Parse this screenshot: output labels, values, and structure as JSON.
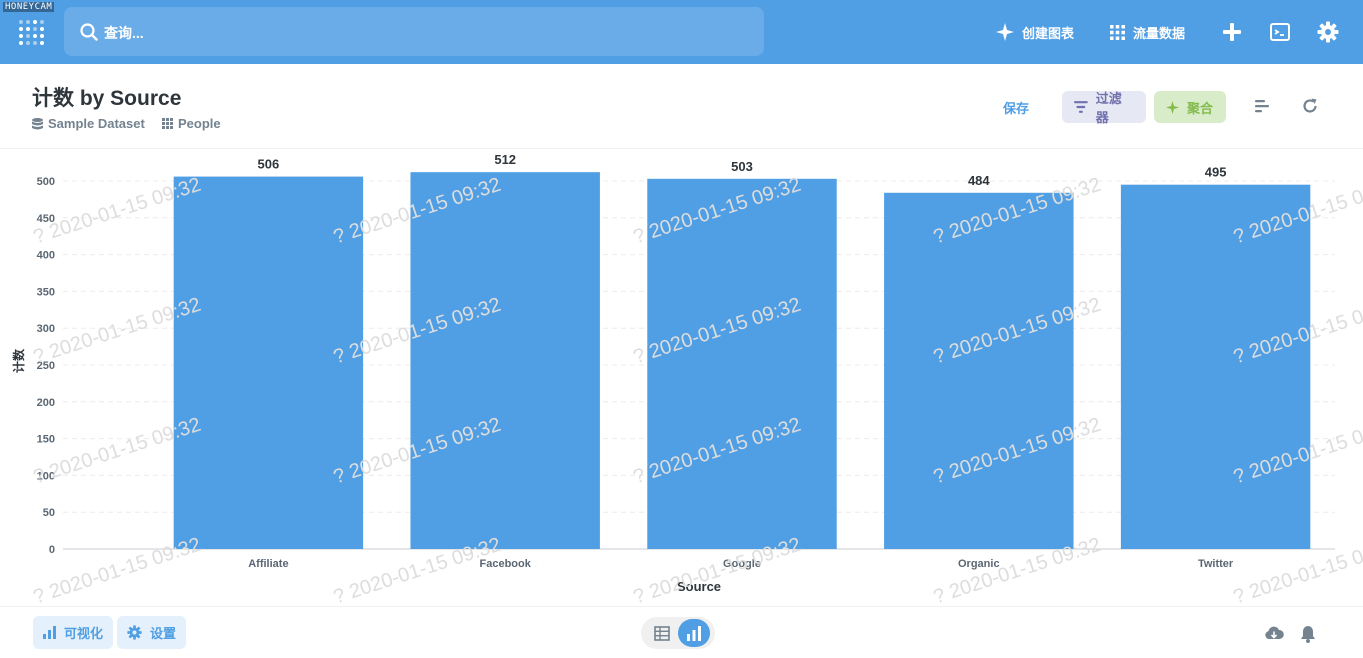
{
  "recorder_badge": "HONEYCAM",
  "nav": {
    "search_placeholder": "查询...",
    "create_chart": "创建图表",
    "browse_data": "流量数据",
    "icons": [
      "logo-icon",
      "search-icon",
      "sparkle-icon",
      "grid-icon",
      "plus-icon",
      "terminal-icon",
      "gear-icon"
    ]
  },
  "question": {
    "title": "计数 by Source",
    "database": "Sample Dataset",
    "table": "People"
  },
  "actions": {
    "save": "保存",
    "filter": "过滤器",
    "summarize": "聚合"
  },
  "watermark_text": "? 2020-01-15 09:32",
  "colors": {
    "brand": "#509ee3",
    "bar": "#509ee3",
    "filter": "#7172ad",
    "summarize": "#84bb4c"
  },
  "chart_data": {
    "type": "bar",
    "categories": [
      "Affiliate",
      "Facebook",
      "Google",
      "Organic",
      "Twitter"
    ],
    "values": [
      506,
      512,
      503,
      484,
      495
    ],
    "xlabel": "Source",
    "ylabel": "计数",
    "ylim": [
      0,
      500
    ],
    "yticks": [
      0,
      50,
      100,
      150,
      200,
      250,
      300,
      350,
      400,
      450,
      500
    ],
    "grid": true,
    "data_labels": true
  },
  "footer": {
    "visualize": "可视化",
    "settings": "设置"
  }
}
